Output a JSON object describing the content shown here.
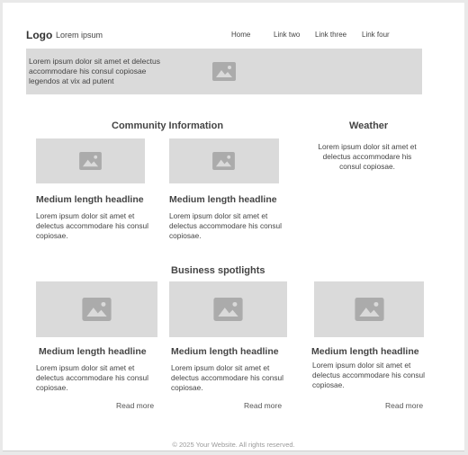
{
  "header": {
    "logo": "Logo",
    "tagline": "Lorem ipsum",
    "nav": [
      "Home",
      "Link two",
      "Link three",
      "Link four"
    ]
  },
  "hero": {
    "text": "Lorem ipsum dolor sit amet et delectus accommodare his consul copiosae legendos at vix ad putent",
    "image_icon": "image-placeholder-icon"
  },
  "community": {
    "title": "Community Information",
    "cards": [
      {
        "headline": "Medium length headline",
        "body": "Lorem ipsum dolor sit amet et delectus accommodare his consul copiosae."
      },
      {
        "headline": "Medium length headline",
        "body": "Lorem ipsum dolor sit amet et delectus accommodare his consul copiosae."
      }
    ]
  },
  "weather": {
    "title": "Weather",
    "body": "Lorem ipsum dolor sit amet et delectus accommodare his consul copiosae."
  },
  "spotlights": {
    "title": "Business spotlights",
    "cards": [
      {
        "headline": "Medium length headline",
        "body": "Lorem ipsum dolor sit amet et delectus accommodare his consul copiosae.",
        "link": "Read more"
      },
      {
        "headline": "Medium length headline",
        "body": "Lorem ipsum dolor sit amet et delectus accommodare his consul copiosae.",
        "link": "Read more"
      },
      {
        "headline": "Medium length headline",
        "body": "Lorem ipsum dolor sit amet et delectus accommodare his consul copiosae.",
        "link": "Read more"
      }
    ]
  },
  "footer": {
    "text": "© 2025 Your Website. All rights reserved."
  },
  "colors": {
    "placeholder": "#dadada",
    "icon": "#ababab",
    "text": "#444444",
    "footer_text": "#9a9a9a"
  }
}
